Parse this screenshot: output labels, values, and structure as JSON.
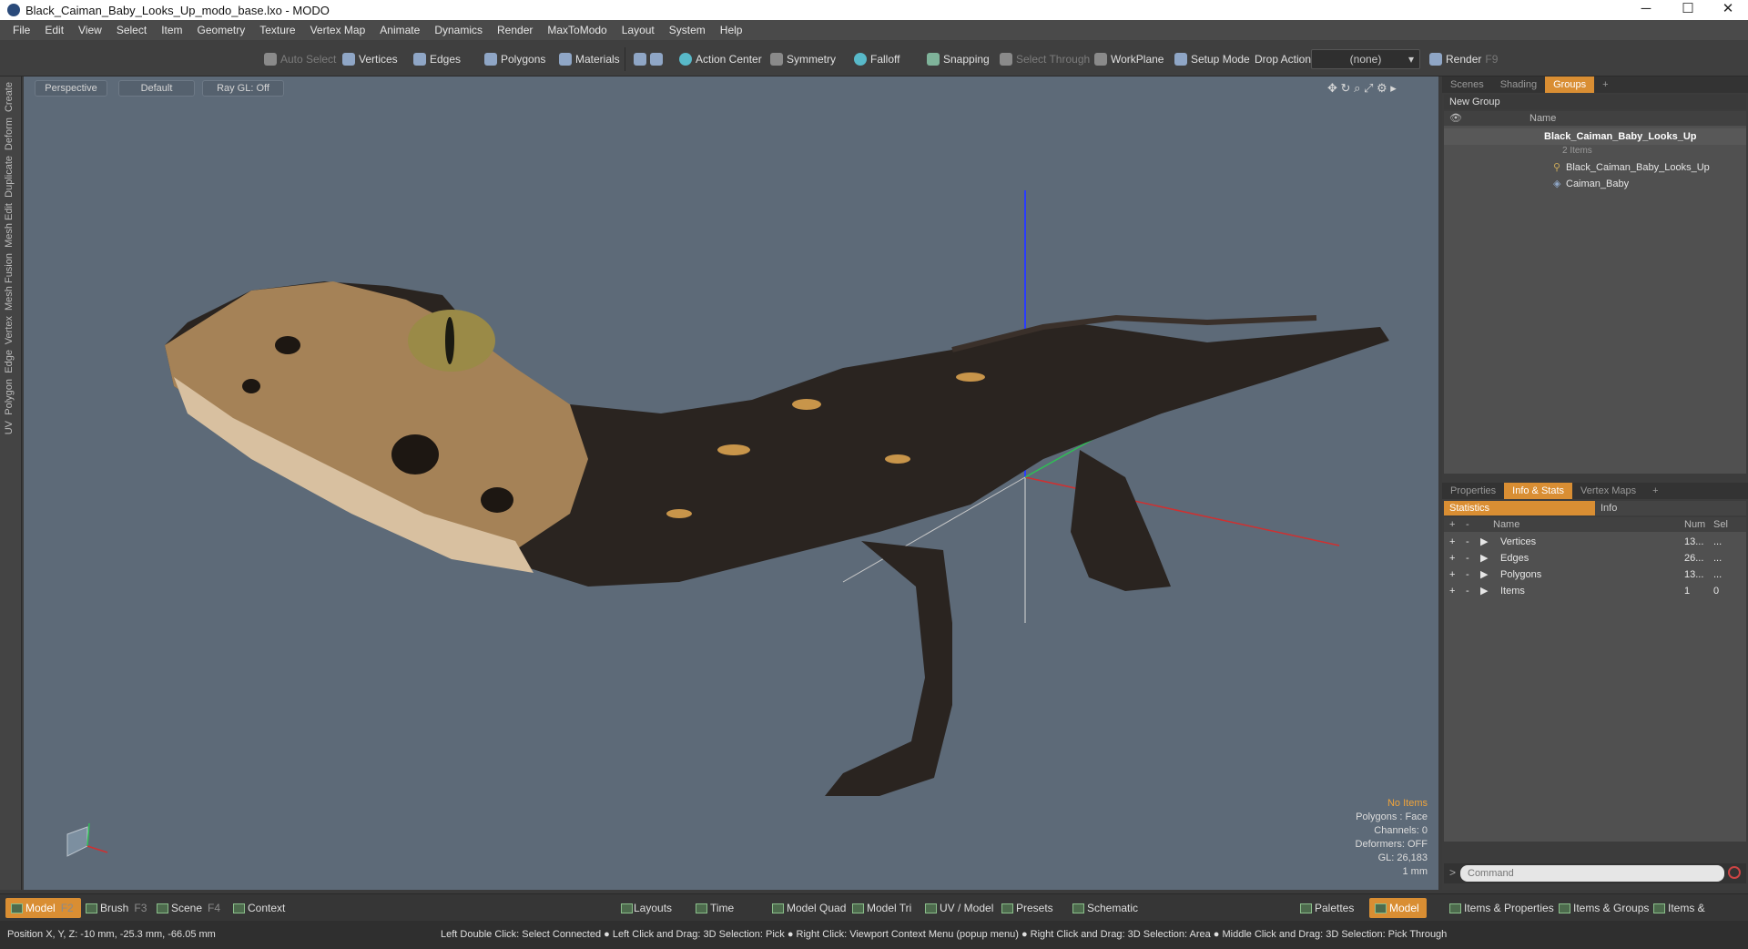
{
  "window": {
    "title": "Black_Caiman_Baby_Looks_Up_modo_base.lxo - MODO",
    "min": "─",
    "max": "☐",
    "close": "✕"
  },
  "menu": [
    "File",
    "Edit",
    "View",
    "Select",
    "Item",
    "Geometry",
    "Texture",
    "Vertex Map",
    "Animate",
    "Dynamics",
    "Render",
    "MaxToModo",
    "Layout",
    "System",
    "Help"
  ],
  "toolbar": {
    "auto_select": "Auto Select",
    "vertices": "Vertices",
    "edges": "Edges",
    "polygons": "Polygons",
    "materials": "Materials",
    "action_center": "Action Center",
    "symmetry": "Symmetry",
    "falloff": "Falloff",
    "snapping": "Snapping",
    "select_through": "Select Through",
    "workplane": "WorkPlane",
    "setup_mode": "Setup Mode",
    "drop_action": "Drop Action",
    "drop_action_value": "(none)",
    "render": "Render",
    "render_key": "F9"
  },
  "left_tabs": [
    "Create",
    "Deform",
    "Duplicate",
    "Mesh Edit",
    "Mesh Fusion",
    "Vertex",
    "Edge",
    "Polygon",
    "UV"
  ],
  "viewport": {
    "view": "Perspective",
    "shading": "Default",
    "raygl": "Ray GL: Off",
    "info": {
      "no_items": "No Items",
      "polygons": "Polygons : Face",
      "channels": "Channels: 0",
      "deformers": "Deformers: OFF",
      "gl": "GL: 26,183",
      "scale": "1 mm"
    },
    "colors": {
      "background": "#5d6a78",
      "x_axis": "#d03030",
      "y_axis": "#2fbf55",
      "z_axis": "#2a3cff"
    }
  },
  "groups_panel": {
    "tabs": [
      "Scenes",
      "Shading",
      "Groups"
    ],
    "active_tab": "Groups",
    "add": "+",
    "new_group": "New Group",
    "col_name": "Name",
    "root": {
      "name": "Black_Caiman_Baby_Looks_Up",
      "count": "2 Items"
    },
    "children": [
      "Black_Caiman_Baby_Looks_Up",
      "Caiman_Baby"
    ]
  },
  "stats_panel": {
    "tabs": [
      "Properties",
      "Info & Stats",
      "Vertex Maps"
    ],
    "active_tab": "Info & Stats",
    "add": "+",
    "subtabs": [
      "Statistics",
      "Info"
    ],
    "headers": {
      "add": "+",
      "rem": "-",
      "name": "Name",
      "num": "Num",
      "sel": "Sel"
    },
    "rows": [
      {
        "name": "Vertices",
        "num": "13...",
        "sel": "..."
      },
      {
        "name": "Edges",
        "num": "26...",
        "sel": "..."
      },
      {
        "name": "Polygons",
        "num": "13...",
        "sel": "..."
      },
      {
        "name": "Items",
        "num": "1",
        "sel": "0"
      }
    ]
  },
  "command": {
    "placeholder": "Command",
    "prompt": ">"
  },
  "bottom": {
    "left": [
      {
        "label": "Model",
        "key": "F2"
      },
      {
        "label": "Brush",
        "key": "F3"
      },
      {
        "label": "Scene",
        "key": "F4"
      },
      {
        "label": "Context",
        "key": ""
      }
    ],
    "center": [
      "Layouts",
      "Time",
      "Model Quad",
      "Model Tri",
      "UV / Model",
      "Presets",
      "Schematic"
    ],
    "right": [
      "Palettes",
      "Model",
      "Items & Properties",
      "Items & Groups",
      "Items & Shading"
    ]
  },
  "status": {
    "position": "Position X, Y, Z:   -10 mm, -25.3 mm, -66.05 mm",
    "hint": "Left Double Click: Select Connected ● Left Click and Drag: 3D Selection: Pick ● Right Click: Viewport Context Menu (popup menu) ● Right Click and Drag: 3D Selection: Area ● Middle Click and Drag: 3D Selection: Pick Through"
  }
}
